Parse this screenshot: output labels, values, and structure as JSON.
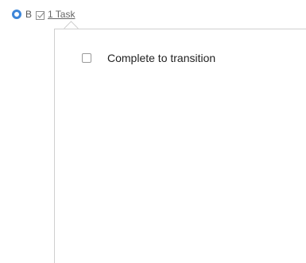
{
  "header": {
    "stage_label": "B",
    "task_link_label": "1 Task",
    "status_icon": "circle-status-icon",
    "task_icon": "checkbox-icon"
  },
  "popover": {
    "tasks": [
      {
        "label": "Complete to transition",
        "checked": false
      }
    ]
  },
  "colors": {
    "accent": "#3d86d8",
    "border": "#cfcfcf",
    "text": "#222222"
  }
}
